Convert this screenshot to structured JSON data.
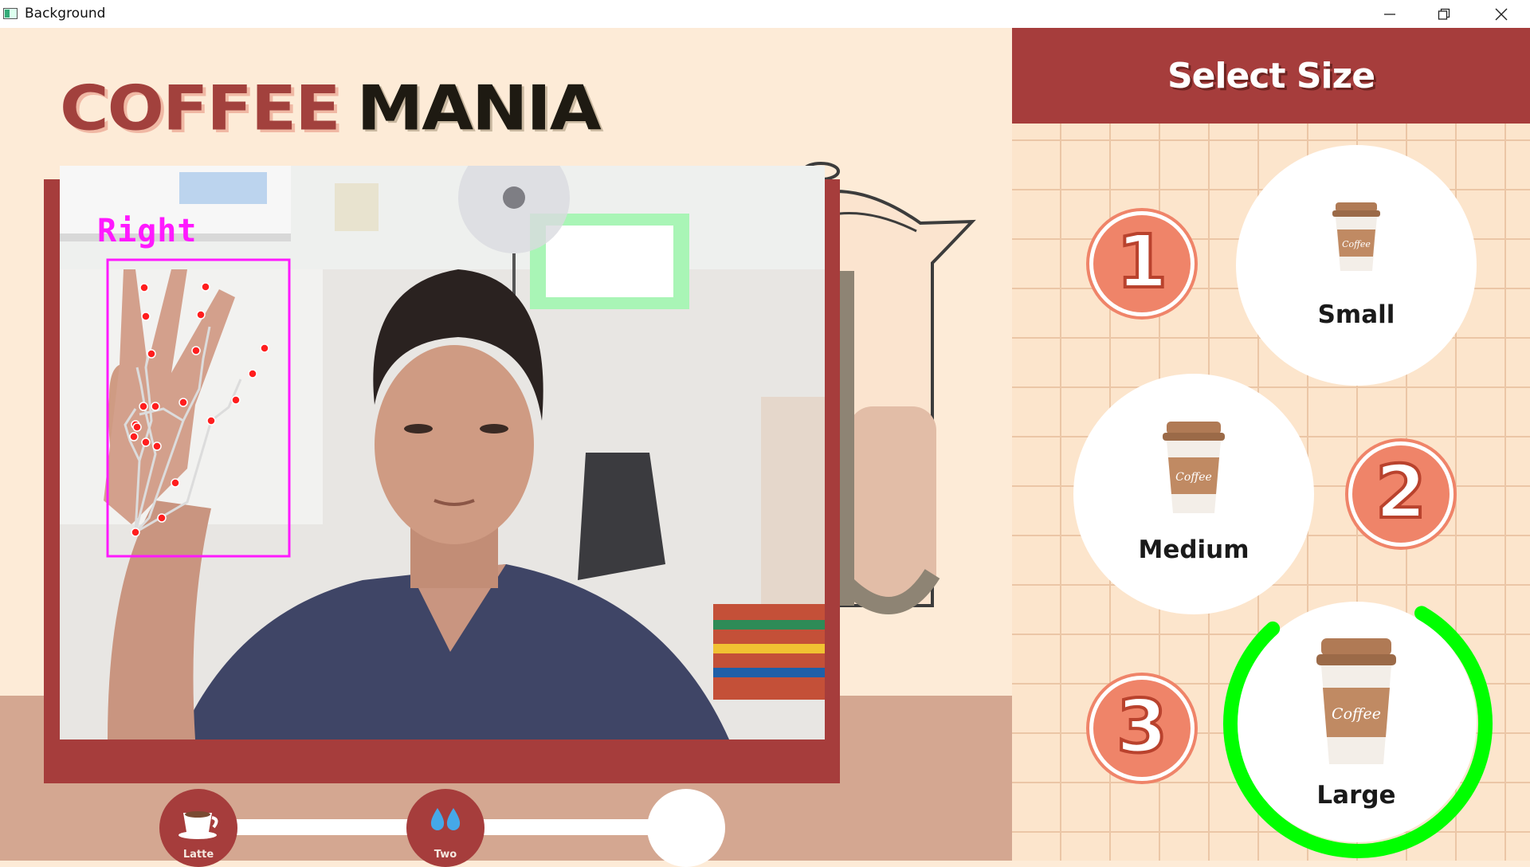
{
  "window": {
    "title": "Background",
    "controls": {
      "minimize_icon": "minimize-icon",
      "restore_icon": "restore-icon",
      "close_icon": "close-icon"
    }
  },
  "logo": {
    "word1": "COFFEE",
    "word2": "MANIA"
  },
  "camera": {
    "hand_label": "Right"
  },
  "progress": {
    "steps": [
      {
        "label": "Latte",
        "icon": "coffee-cup-icon",
        "state": "done"
      },
      {
        "label": "Two",
        "icon": "water-drops-icon",
        "state": "done"
      },
      {
        "label": "",
        "icon": "",
        "state": "pending"
      }
    ]
  },
  "size_panel": {
    "header": "Select Size",
    "options": [
      {
        "number": "1",
        "name": "Small",
        "selected": false
      },
      {
        "number": "2",
        "name": "Medium",
        "selected": false
      },
      {
        "number": "3",
        "name": "Large",
        "selected": true,
        "progress": 0.8
      }
    ]
  },
  "colors": {
    "brand_red": "#a63d3c",
    "badge_coral": "#ef8469",
    "background_cream": "#fdebd7",
    "selection_green": "#00ff00",
    "hand_box": "#ff19ff"
  }
}
